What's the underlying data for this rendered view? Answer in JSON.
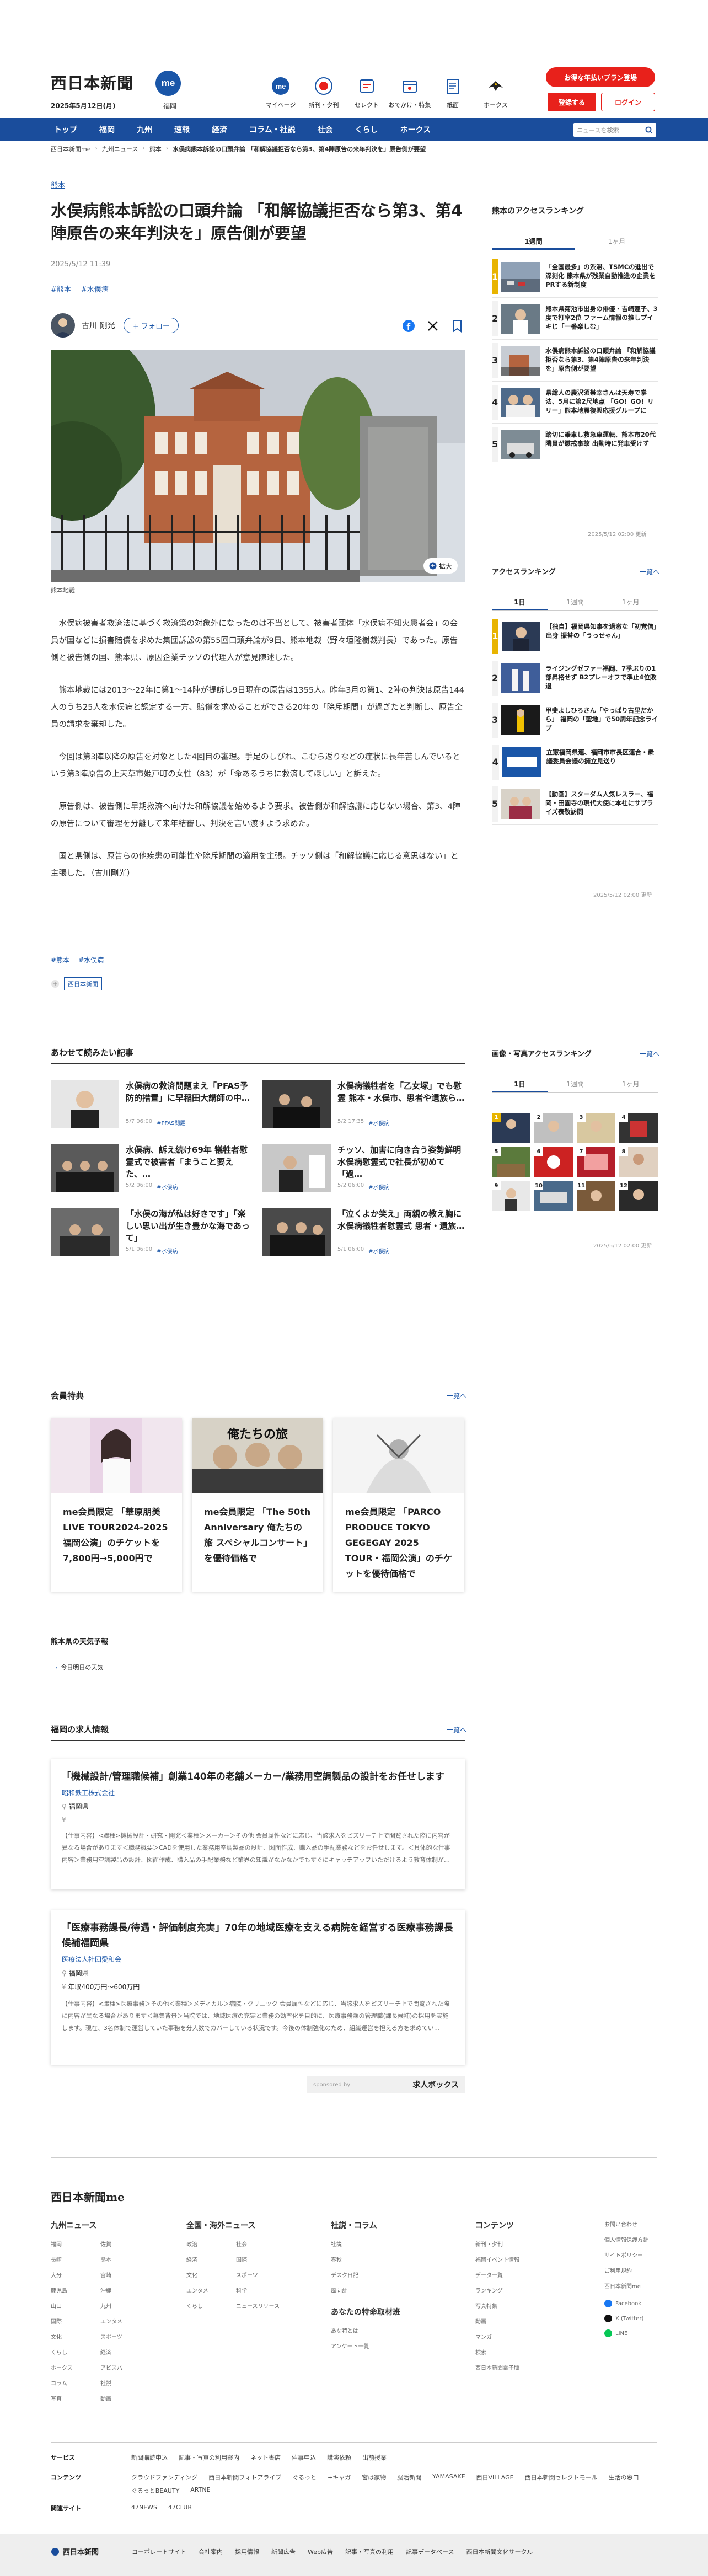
{
  "header": {
    "logo": "西日本新聞",
    "me_badge": "me",
    "date": "2025年5月12日(月)",
    "area": "福岡",
    "nav": [
      {
        "label": "マイページ",
        "icon": "me-icon"
      },
      {
        "label": "新刊・夕刊",
        "icon": "newspaper-icon"
      },
      {
        "label": "セレクト",
        "icon": "select-icon"
      },
      {
        "label": "おでかけ・特集",
        "icon": "outing-icon"
      },
      {
        "label": "紙面",
        "icon": "paper-icon"
      },
      {
        "label": "ホークス",
        "icon": "hawks-icon"
      }
    ],
    "promo": "お得な年払いプラン登場",
    "register": "登録する",
    "login": "ログイン"
  },
  "gnav": {
    "items": [
      "トップ",
      "福岡",
      "九州",
      "速報",
      "経済",
      "コラム・社説",
      "社会",
      "くらし",
      "ホークス"
    ],
    "search_placeholder": "ニュースを検索"
  },
  "breadcrumb": [
    "西日本新聞me",
    "九州ニュース",
    "熊本",
    "水俣病熊本訴訟の口頭弁論 「和解協議拒否なら第3、第4陣原告の来年判決を」原告側が要望"
  ],
  "article": {
    "category": "熊本",
    "title": "水俣病熊本訴訟の口頭弁論 「和解協議拒否なら第3、第4陣原告の来年判決を」原告側が要望",
    "date": "2025/5/12 11:39",
    "tags": [
      "#熊本",
      "#水俣病"
    ],
    "author": "古川 剛光",
    "follow": "+ フォロー",
    "zoom": "拡大",
    "caption": "熊本地裁",
    "paragraphs": [
      "水俣病被害者救済法に基づく救済策の対象外になったのは不当として、被害者団体「水俣病不知火患者会」の会員が国などに損害賠償を求めた集団訴訟の第55回口頭弁論が9日、熊本地裁（野々垣隆樹裁判長）であった。原告側と被告側の国、熊本県、原因企業チッソの代理人が意見陳述した。",
      "熊本地裁には2013～22年に第1～14陣が提訴し9日現在の原告は1355人。昨年3月の第1、2陣の判決は原告144人のうち25人を水俣病と認定する一方、賠償を求めることができる20年の「除斥期間」が過ぎたと判断し、原告全員の請求を棄却した。",
      "今回は第3陣以降の原告を対象とした4回目の審理。手足のしびれ、こむら返りなどの症状に長年苦しんでいるという第3陣原告の上天草市姫戸町の女性（83）が「命あるうちに救済してほしい」と訴えた。",
      "原告側は、被告側に早期救済へ向けた和解協議を始めるよう要求。被告側が和解協議に応じない場合、第3、4陣の原告について審理を分離して来年結審し、判決を言い渡すよう求めた。",
      "国と県側は、原告らの他疾患の可能性や除斥期間の適用を主張。チッソ側は「和解協議に応じる意思はない」と主張した。（古川剛光）"
    ],
    "tags_bottom": [
      "#熊本",
      "#水俣病"
    ],
    "source_box": "西日本新聞"
  },
  "sidebar": {
    "access_title": "熊本のアクセスランキング",
    "tabs1": [
      "1週間",
      "1ヶ月"
    ],
    "ranking1": [
      {
        "n": "1",
        "text": "「全国最多」の渋滞、TSMCの進出で深刻化 熊本県が残業自動推進の企業をPRする新制度"
      },
      {
        "n": "2",
        "text": "熊本県菊池市出身の俳優・吉崎蓮子、3度で打率2位 ファーム情報の推しプイキじ「一番楽しむ」"
      },
      {
        "n": "3",
        "text": "水俣病熊本訴訟の口頭弁論 「和解協議拒否なら第3、第4陣原告の来年判決を」原告側が要望"
      },
      {
        "n": "4",
        "text": "県総人の農沢須帯幸さんは天寿で拳法、5月に第2尺地点 「GO！GO！リリー」熊本地震復興応援グループに"
      },
      {
        "n": "5",
        "text": "踏切に乗車し救急車運転、熊本市20代隣員が懲戒事故 出勤時に発車受けず"
      }
    ],
    "time1": "2025/5/12 02:00 更新",
    "access2_title": "アクセスランキング",
    "more": "一覧へ",
    "tabs2": [
      "1日",
      "1週間",
      "1ヶ月"
    ],
    "ranking2": [
      {
        "n": "1",
        "text": "【独自】福岡県知事を過激な「初覚信」出身 振替の「うっせゃん」"
      },
      {
        "n": "2",
        "text": "ライジングゼファー福岡、7季ぶりの1部昇格せず B2プレーオフで準止4位敗退"
      },
      {
        "n": "3",
        "text": "甲斐よしひろさん「やっぱり古里だから」 福岡の「聖地」で50周年記念ライブ"
      },
      {
        "n": "4",
        "text": "立憲福岡県連、福岡市市長区連合・衆議委員会議の擁立見送り"
      },
      {
        "n": "5",
        "text": "【動画】スターダム人気レスラー、福岡・田園寺の現代大使に本社にサプライズ表敬訪問"
      }
    ],
    "time2": "2025/5/12 02:00 更新",
    "img_title": "画像・写真アクセスランキング",
    "tabs3": [
      "1日",
      "1週間",
      "1ヶ月"
    ],
    "time3": "2025/5/12 02:00 更新"
  },
  "related": {
    "title": "あわせて読みたい記事",
    "items": [
      {
        "title": "水俣病の救済問題まえ「PFAS予防的措置」に早稲田大講師の中…",
        "date": "5/7 06:00",
        "tag": "#PFAS問題"
      },
      {
        "title": "水俣病犠牲者を「乙女塚」でも慰霊 熊本・水俣市、患者や遺族ら…",
        "date": "5/2 17:35",
        "tag": "#水俣病"
      },
      {
        "title": "水俣病、訴え続け69年 犠牲者慰霊式で被害者「まうこと要えた、…",
        "date": "5/2 06:00",
        "tag": "#水俣病"
      },
      {
        "title": "チッソ、加害に向き合う姿勢鮮明 水俣病慰霊式で社長が初めて「過…",
        "date": "5/2 06:00",
        "tag": "#水俣病"
      },
      {
        "title": "「水俣の海が私は好きです」「楽しい思い出が生き豊かな海であって」",
        "date": "5/1 06:00",
        "tag": "#水俣病"
      },
      {
        "title": "「泣くよか笑え」両親の教え胸に 水俣病犠牲者慰霊式 患者・遺族…",
        "date": "5/1 06:00",
        "tag": "#水俣病"
      }
    ]
  },
  "member": {
    "title": "会員特典",
    "more": "一覧へ",
    "cards": [
      "me会員限定 「華原朋美LIVE TOUR2024-2025 福岡公演」のチケットを7,800円→5,000円で",
      "me会員限定 「The 50th Anniversary 俺たちの旅 スペシャルコンサート」を優待価格で",
      "me会員限定 「PARCO PRODUCE TOKYO GEGEGAY 2025 TOUR・福岡公演」のチケットを優待価格で"
    ],
    "card2_img_text": "俺たちの旅"
  },
  "weather": {
    "title": "熊本県の天気予報",
    "item": "今日明日の天気"
  },
  "jobs": {
    "title": "福岡の求人情報",
    "more": "一覧へ",
    "items": [
      {
        "title": "「機械設計/管理職候補」創業140年の老舗メーカー/業務用空調製品の設計をお任せします",
        "company": "昭和鉄工株式会社",
        "loc": "福岡県",
        "salary": "",
        "desc": "【仕事内容】<職種>機械設計・研究・開発＜業種＞メーカー＞その他 会員属性などに応じ、当該求人をピズリーチ上で閲覧された際に内容が異なる場合があります＜職務概要＞CADを使用した業務用空調製品の設計、図面作成、購入品の手配業務などをお任せします。＜具体的な仕事内容＞業務用空調製品の設計、図面作成、購入品の手配業務など業界の知識がなかなかでもすぐにキャッチアップいただけるよう教育体制が…"
      },
      {
        "title": "「医療事務課長/待遇・評価制度充実」70年の地域医療を支える病院を経営する医療事務課長候補福岡県",
        "company": "医療法人社団愛和会",
        "loc": "福岡県",
        "salary": "年収400万円～600万円",
        "desc": "【仕事内容】<職種>医療事務＞その他＜業種＞メディカル＞病院・クリニック 会員属性などに応じ、当該求人をピズリーチ上で閲覧された際に内容が異なる場合があります＜募集背景＞当院では、地域医療の充実と業務の効率化を目的に、医療事務課の管理職(課長候補)の採用を実施します。現在、3名体制で運営していた事務を分人数でカバーしている状況です。今後の体制強化のため、組織運営を担える方を求めてい…"
      }
    ],
    "sponsored": "sponsored by",
    "sponsor_name": "求人ボックス"
  },
  "footer": {
    "logo": "西日本新聞me",
    "col1_title": "九州ニュース",
    "col1": [
      "福岡",
      "佐賀",
      "長崎",
      "熊本",
      "大分",
      "宮崎",
      "鹿児島",
      "沖縄",
      "山口",
      "九州",
      "国際",
      "エンタメ",
      "文化",
      "スポーツ",
      "くらし",
      "経済",
      "ホークス",
      "アビスパ",
      "コラム",
      "社説",
      "写真",
      "動画"
    ],
    "col2_title": "全国・海外ニュース",
    "col2": [
      "政治",
      "社会",
      "経済",
      "国際",
      "文化",
      "スポーツ",
      "エンタメ",
      "科学",
      "くらし",
      "ニュースリリース"
    ],
    "col3_title": "社説・コラム",
    "col3": [
      "社説",
      "春秋",
      "デスク日記",
      "風向計"
    ],
    "col3b_title": "あなたの特命取材班",
    "col3b": [
      "あな特とは",
      "アンケート一覧"
    ],
    "col4_title": "コンテンツ",
    "col4": [
      "新刊・夕刊",
      "福岡イベント情報",
      "データ一覧",
      "ランキング",
      "写真特集",
      "動画",
      "マンガ",
      "検索",
      "西日本新聞電子版"
    ],
    "col5": [
      "お問い合わせ",
      "個人情報保護方針",
      "サイトポリシー",
      "ご利用規約",
      "西日本新聞me"
    ],
    "social": [
      "Facebook",
      "X (Twitter)",
      "LINE"
    ],
    "services_label": "サービス",
    "services": [
      "新聞購読申込",
      "記事・写真の利用案内",
      "ネット書店",
      "催事申込",
      "講演依頼",
      "出前授業"
    ],
    "contents_label": "コンテンツ",
    "contents": [
      "クラウドファンディング",
      "西日本新聞フォトアライブ",
      "ぐるっと",
      "+キャガ",
      "宮は家物",
      "脳活新聞",
      "YAMASAKE",
      "西日VILLAGE",
      "西日本新聞セレクトモール",
      "生活の窓口",
      "ぐるっとBEAUTY",
      "ARTNE"
    ],
    "related_label": "関連サイト",
    "related": [
      "47NEWS",
      "47CLUB"
    ],
    "bottom_logo": "西日本新聞",
    "bottom_links": [
      "コーポレートサイト",
      "会社案内",
      "採用情報",
      "新聞広告",
      "Web広告",
      "記事・写真の利用",
      "記事データベース",
      "西日本新聞文化サークル"
    ]
  },
  "colors": {
    "brand": "#1a4d9c",
    "accent": "#e8211b",
    "link": "#1a56a8",
    "rank_gold": "#e8b400"
  }
}
